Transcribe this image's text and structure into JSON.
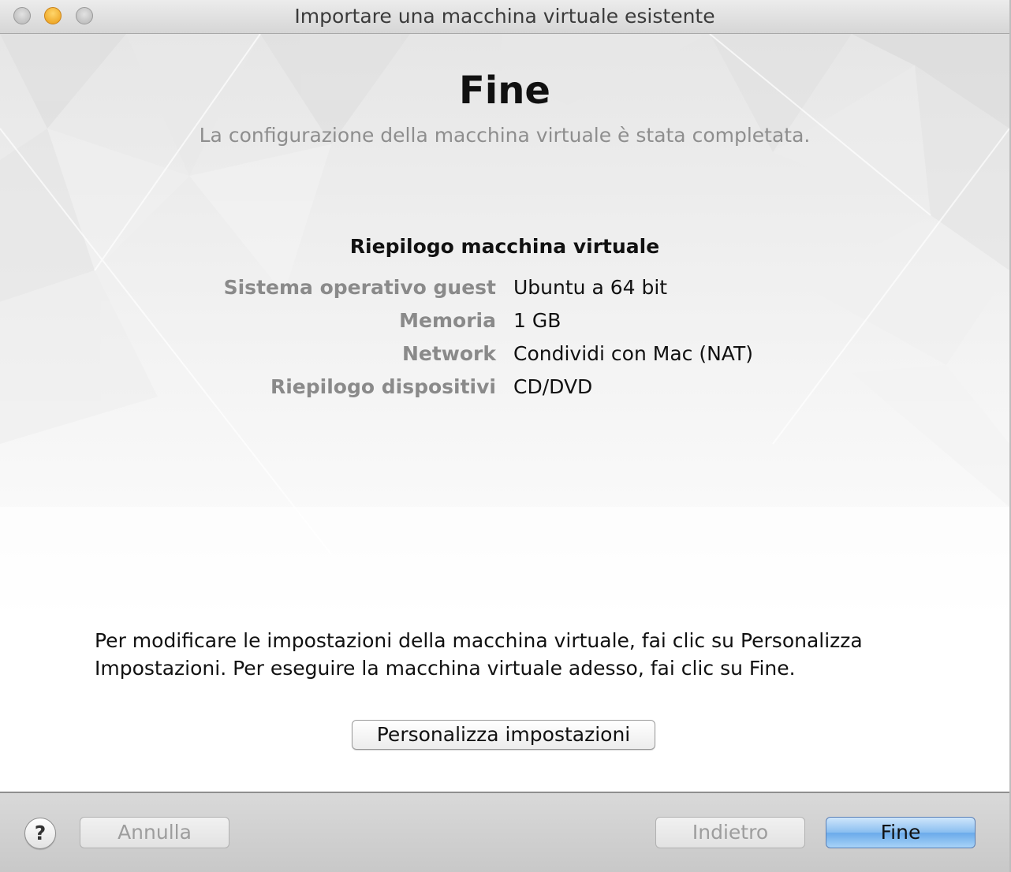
{
  "window": {
    "title": "Importare una macchina virtuale esistente"
  },
  "main": {
    "heading": "Fine",
    "subheading": "La configurazione della macchina virtuale è stata completata.",
    "summary": {
      "title": "Riepilogo macchina virtuale",
      "rows": [
        {
          "label": "Sistema operativo guest",
          "value": "Ubuntu a 64 bit"
        },
        {
          "label": "Memoria",
          "value": "1 GB"
        },
        {
          "label": "Network",
          "value": "Condividi con Mac (NAT)"
        },
        {
          "label": "Riepilogo dispositivi",
          "value": "CD/DVD"
        }
      ]
    },
    "info_line1": "Per modificare le impostazioni della macchina virtuale, fai clic su Personalizza",
    "info_line2": "Impostazioni. Per eseguire la macchina virtuale adesso, fai clic su Fine.",
    "customize_label": "Personalizza impostazioni"
  },
  "footer": {
    "help_label": "?",
    "cancel_label": "Annulla",
    "back_label": "Indietro",
    "finish_label": "Fine"
  },
  "colors": {
    "default_button": "#89bef0",
    "disabled_text": "#9d9d9d",
    "label_gray": "#8a8a8a"
  },
  "icons": {
    "close": "close-icon",
    "minimize": "minimize-icon",
    "zoom": "zoom-icon",
    "help": "help-icon"
  }
}
